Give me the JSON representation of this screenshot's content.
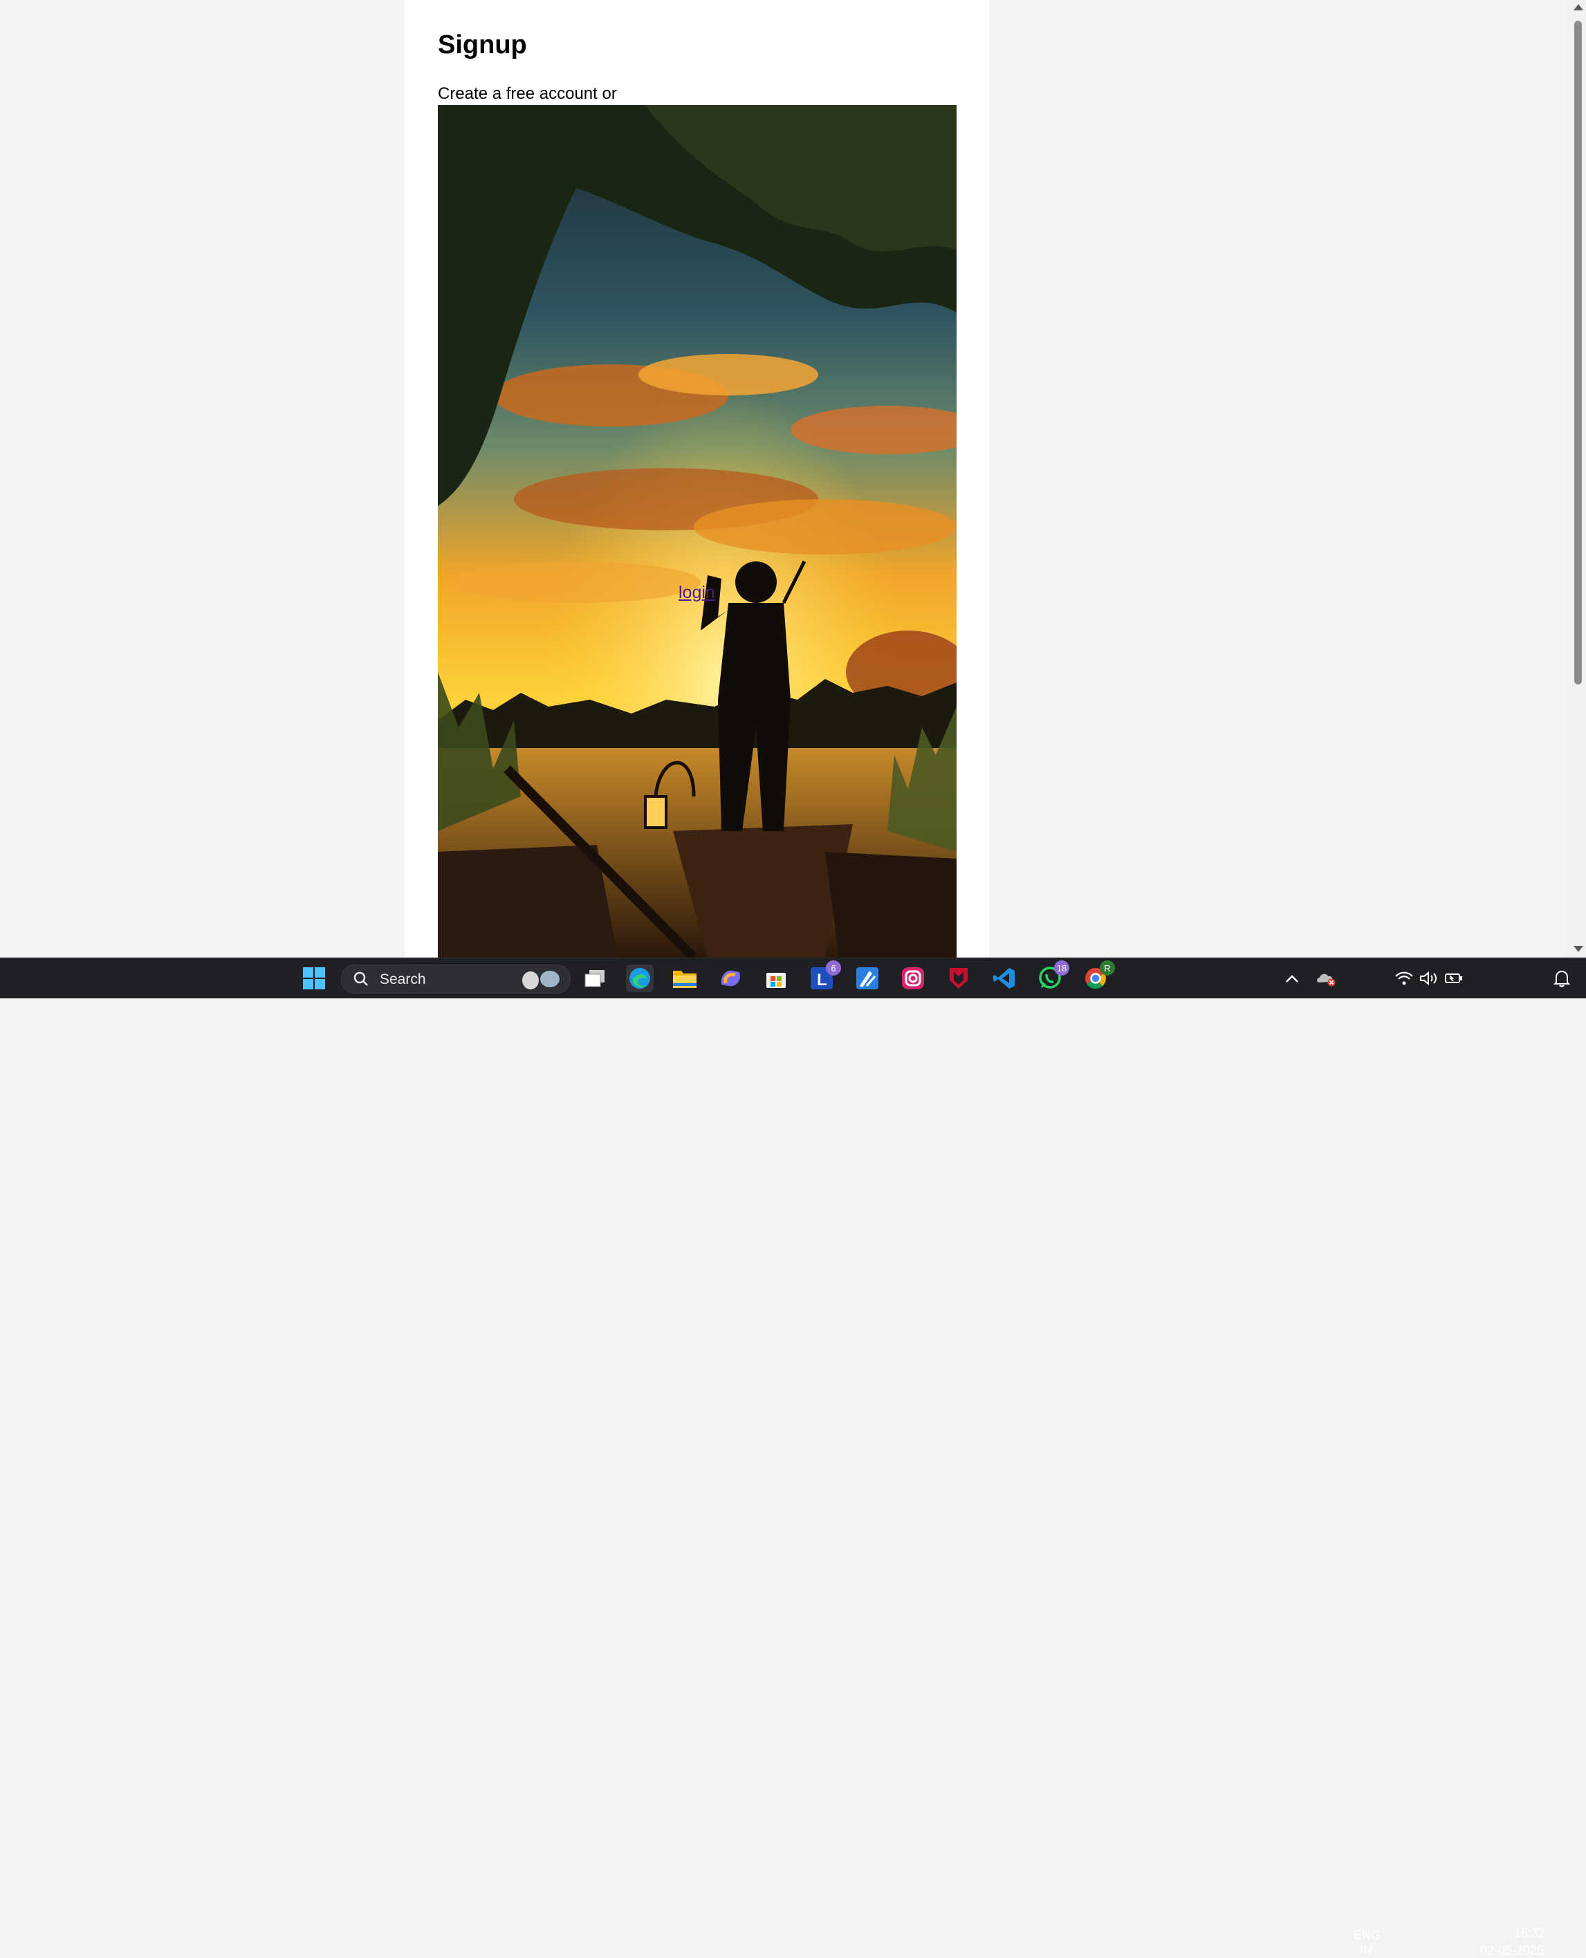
{
  "page": {
    "title": "Signup",
    "intro_text": "Create a free account or",
    "login_link": "login"
  },
  "taskbar": {
    "search_placeholder": "Search",
    "apps": [
      {
        "name": "start",
        "icon": "windows-start-icon"
      },
      {
        "name": "task-view",
        "icon": "task-view-icon"
      },
      {
        "name": "edge",
        "icon": "edge-icon"
      },
      {
        "name": "file-explorer",
        "icon": "folder-icon"
      },
      {
        "name": "copilot",
        "icon": "copilot-icon"
      },
      {
        "name": "store",
        "icon": "store-icon"
      },
      {
        "name": "app-l",
        "icon": "l-app-icon",
        "badge": "6"
      },
      {
        "name": "app-draw",
        "icon": "draw-app-icon"
      },
      {
        "name": "instagram",
        "icon": "instagram-icon"
      },
      {
        "name": "mcafee",
        "icon": "shield-app-icon"
      },
      {
        "name": "vscode",
        "icon": "vscode-icon"
      },
      {
        "name": "whatsapp",
        "icon": "whatsapp-icon",
        "badge": "18"
      },
      {
        "name": "chrome",
        "icon": "chrome-icon",
        "badge": "R"
      }
    ],
    "tray": {
      "language_line1": "ENG",
      "language_line2": "IN",
      "time": "16:32",
      "date": "02-05-2025"
    }
  },
  "colors": {
    "page_bg": "#f3f3f3",
    "content_bg": "#ffffff",
    "link": "#4b1d83",
    "taskbar": "#1f2023"
  }
}
